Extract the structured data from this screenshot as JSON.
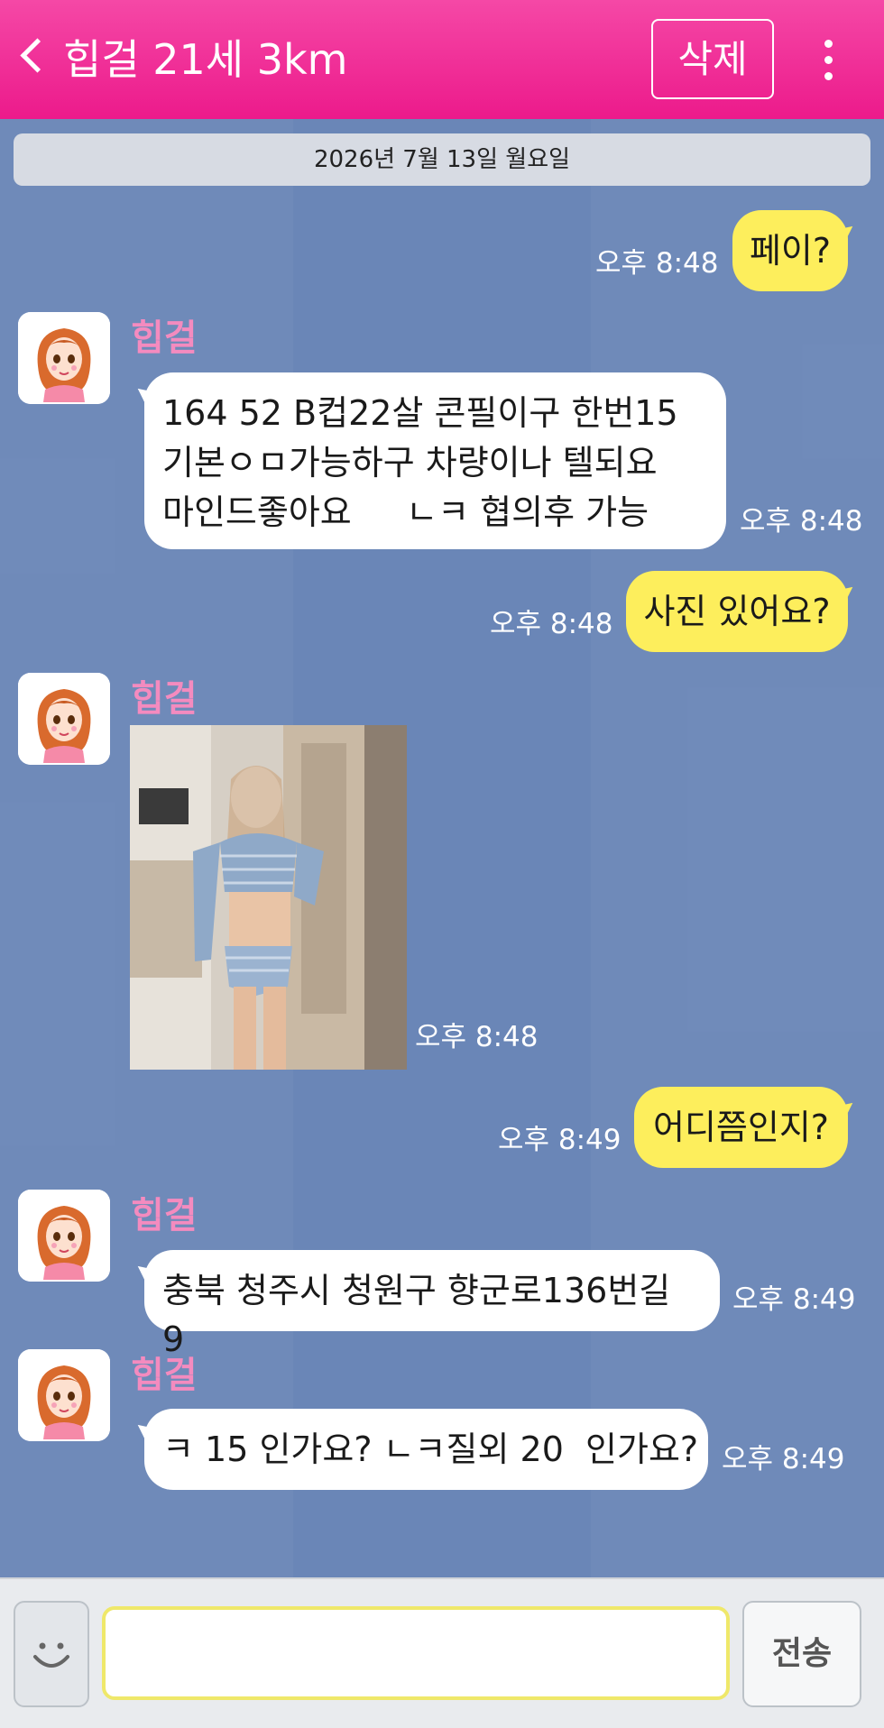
{
  "header": {
    "title": "힙걸 21세 3km",
    "delete_label": "삭제"
  },
  "date_separator": "2026년 7월 13일 월요일",
  "messages": [
    {
      "side": "out",
      "text": "페이?",
      "time": "오후 8:48"
    },
    {
      "side": "in",
      "sender": "힙걸",
      "lines": [
        "164 52 B컵22살  콘필이구 한번15",
        "기본ㅇㅁ가능하구 차량이나 텔되요",
        "마인드좋아요     ㄴㅋ 협의후 가능"
      ],
      "time": "오후 8:48"
    },
    {
      "side": "out",
      "text": "사진 있어요?",
      "time": "오후 8:48"
    },
    {
      "side": "in",
      "sender": "힙걸",
      "type": "photo",
      "time": "오후 8:48"
    },
    {
      "side": "out",
      "text": "어디쯤인지?",
      "time": "오후 8:49"
    },
    {
      "side": "in",
      "sender": "힙걸",
      "text": "충북 청주시 청원구 향군로136번길 9",
      "time": "오후 8:49"
    },
    {
      "side": "in",
      "sender": "힙걸",
      "text": "ㅋ 15 인가요? ㄴㅋ질외 20  인가요?",
      "time": "오후 8:49"
    }
  ],
  "input": {
    "value": "",
    "send_label": "전송"
  },
  "colors": {
    "header": "#ec1a8b",
    "chat_background": "#6a86b7",
    "outgoing_bubble": "#fdee5c",
    "incoming_bubble": "#ffffff",
    "sender_name": "#f48bbf"
  }
}
